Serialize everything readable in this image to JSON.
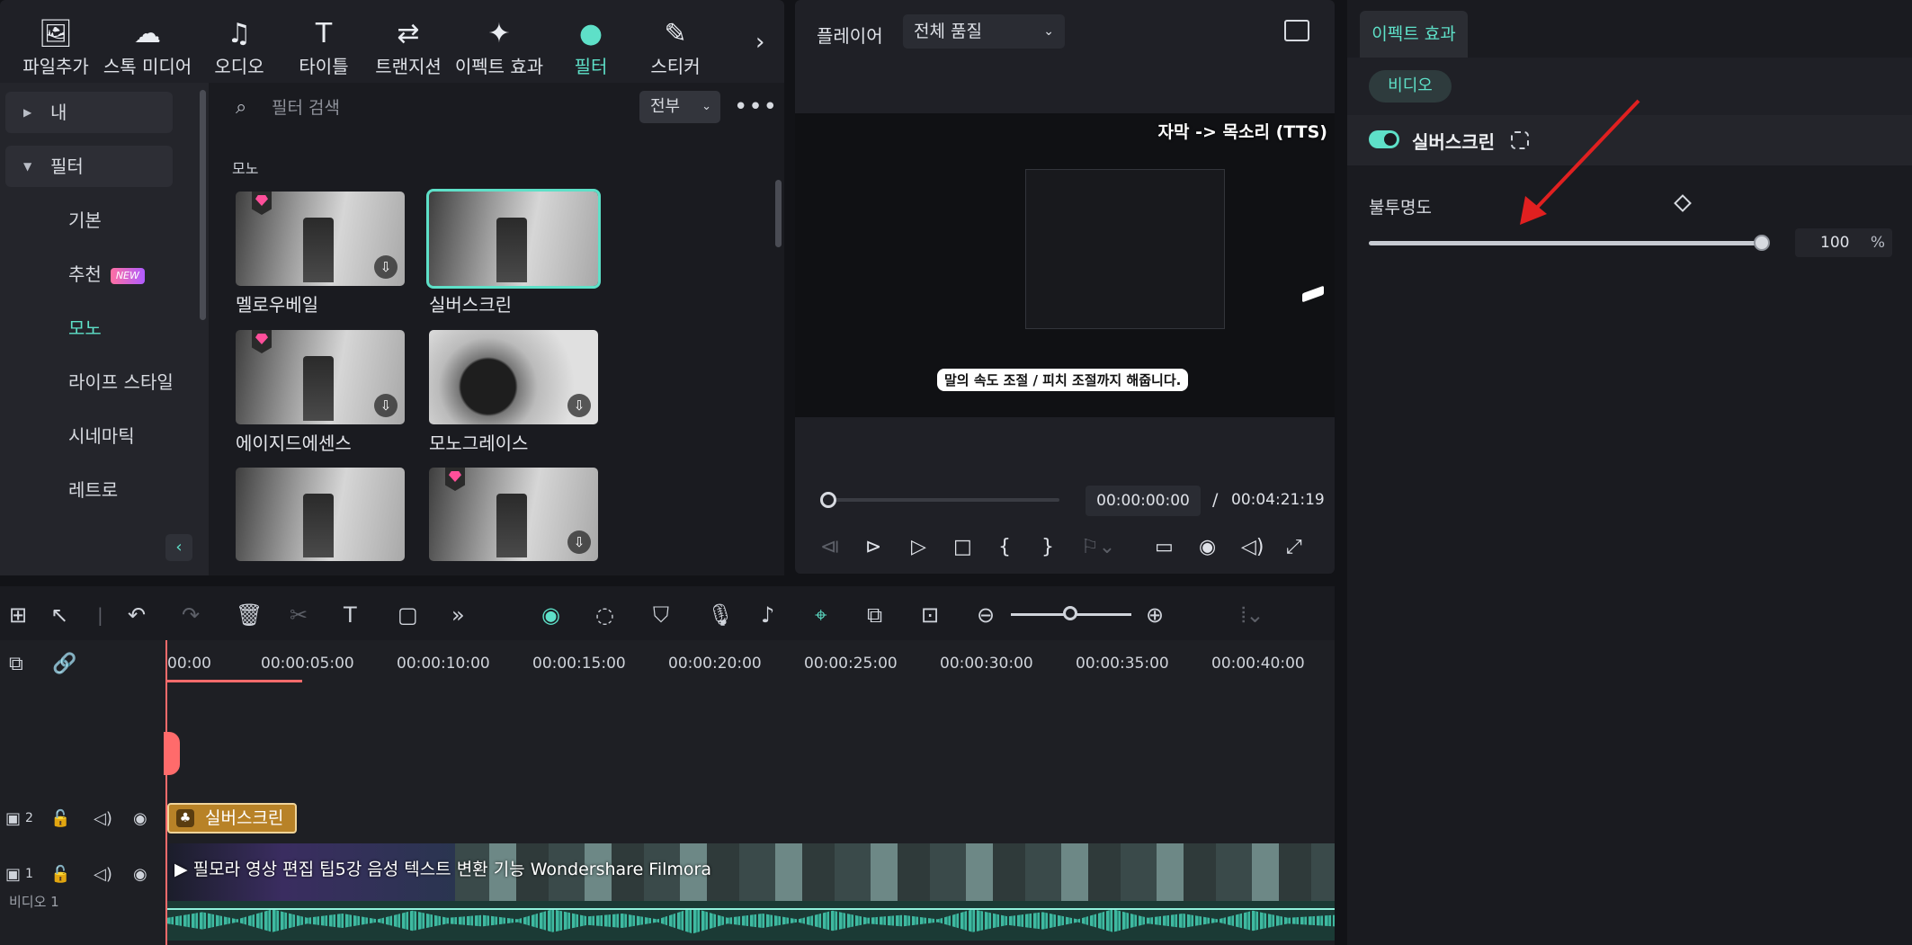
{
  "toolbar": {
    "tabs": [
      {
        "label": "파일추가",
        "icon": "import-icon"
      },
      {
        "label": "스톡 미디어",
        "icon": "cloud-media-icon"
      },
      {
        "label": "오디오",
        "icon": "music-note-icon"
      },
      {
        "label": "타이틀",
        "icon": "text-t-icon"
      },
      {
        "label": "트랜지션",
        "icon": "transition-icon"
      },
      {
        "label": "이펙트 효과",
        "icon": "sparkle-star-icon"
      },
      {
        "label": "필터",
        "icon": "filter-circles-icon"
      },
      {
        "label": "스티커",
        "icon": "sticker-icon"
      }
    ],
    "active_tab": "필터",
    "more_icon": "›"
  },
  "sidebar": {
    "items": [
      {
        "label": "내",
        "type": "group"
      },
      {
        "label": "필터",
        "type": "group"
      },
      {
        "label": "기본"
      },
      {
        "label": "추천",
        "badge": "NEW"
      },
      {
        "label": "모노",
        "selected": true
      },
      {
        "label": "라이프 스타일"
      },
      {
        "label": "시네마틱"
      },
      {
        "label": "레트로"
      }
    ]
  },
  "filters": {
    "search_placeholder": "필터 검색",
    "scope": "전부",
    "group_label": "모노",
    "items": [
      {
        "name": "멜로우베일",
        "premium": true,
        "download": true
      },
      {
        "name": "실버스크린",
        "selected": true
      },
      {
        "name": "에이지드에센스",
        "premium": true,
        "download": true
      },
      {
        "name": "모노그레이스",
        "download": true
      },
      {
        "name": "",
        "premium": false
      },
      {
        "name": "",
        "premium": true,
        "download": true
      }
    ]
  },
  "player": {
    "label": "플레이어",
    "quality": "전체 품질",
    "overlay_title": "자막 -> 목소리 (TTS)",
    "overlay_subtitle": "말의 속도 조절 / 피치 조절까지 해줍니다.",
    "current_time": "00:00:00:00",
    "separator": "/",
    "total_time": "00:04:21:19"
  },
  "inspector": {
    "tab": "이펙트 효과",
    "subtab": "비디오",
    "effect_name": "실버스크린",
    "effect_enabled": true,
    "opacity_label": "불투명도",
    "opacity_value": "100",
    "opacity_unit": "%",
    "opacity_fraction": 1.0,
    "annotation_arrow_color": "#e02020"
  },
  "timeline": {
    "ruler": [
      "00:00",
      "00:00:05:00",
      "00:00:10:00",
      "00:00:15:00",
      "00:00:20:00",
      "00:00:25:00",
      "00:00:30:00",
      "00:00:35:00",
      "00:00:40:00"
    ],
    "tracks": [
      {
        "number": "2"
      },
      {
        "number": "1",
        "name": "비디오 1"
      }
    ],
    "filter_clip": "실버스크린",
    "video_clip": "필모라 영상 편집 팁5강 음성 텍스트 변환 기능    Wondershare Filmora"
  },
  "colors": {
    "accent": "#5ee0c8",
    "playhead": "#ff6b6b",
    "filter_clip": "#b88227",
    "panel": "#1f2026",
    "background": "#121317"
  }
}
